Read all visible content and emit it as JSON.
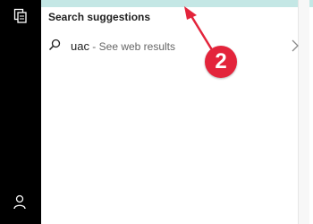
{
  "search": {
    "section_title": "Search suggestions",
    "suggestion": {
      "query": "uac",
      "separator": " - ",
      "subtext": "See web results"
    }
  },
  "annotation": {
    "step_number": "2",
    "color": "#e3243b"
  },
  "icons": {
    "left_rail": [
      "documents-icon",
      "user-icon"
    ],
    "suggestion": [
      "search-icon",
      "chevron-right-icon"
    ]
  },
  "colors": {
    "top_strip": "#c4e7e5",
    "rail_background": "#000000"
  }
}
